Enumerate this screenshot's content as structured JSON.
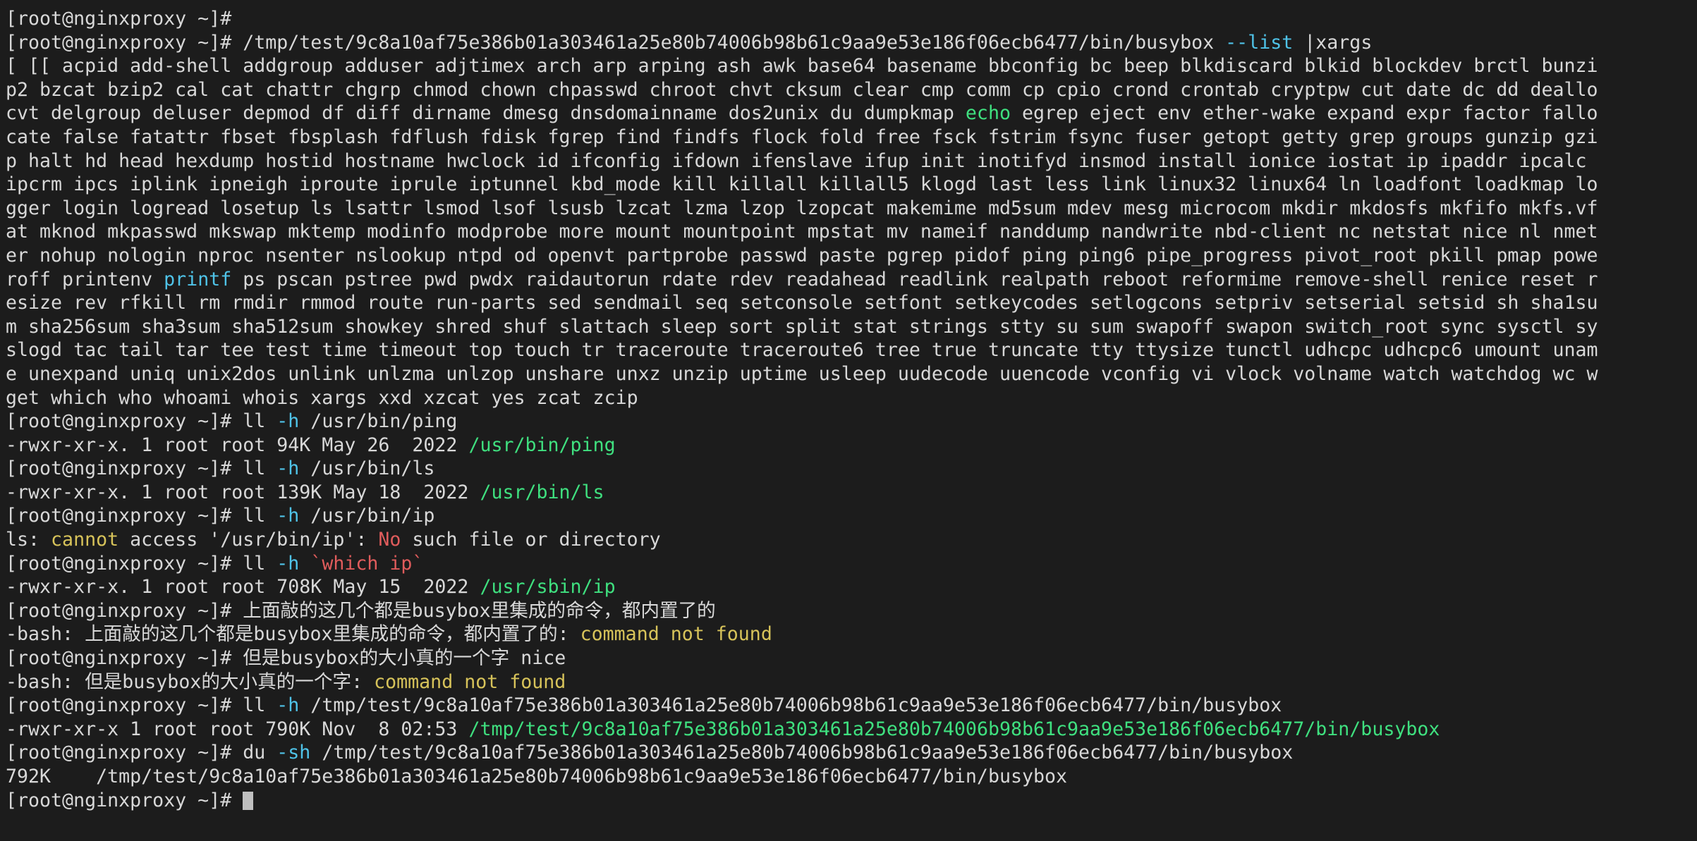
{
  "terminal": {
    "background_color": "#1c1c1c",
    "foreground_color": "#d8d8d8",
    "accent_cyan": "#4fc3e8",
    "accent_green": "#3fe07f",
    "accent_red": "#e05c5c",
    "accent_yellow": "#d7c35a",
    "prompt": "[root@nginxproxy ~]#",
    "busybox_path": "/tmp/test/9c8a10af75e386b01a303461a25e80b74006b98b61c9aa9e53e186f06ecb6477/bin/busybox",
    "lines": [
      {
        "id": "line-01-prompt-empty",
        "segments": [
          {
            "t": "[root@nginxproxy ~]# ",
            "c": "w"
          }
        ]
      },
      {
        "id": "line-02-busybox-list-cmd",
        "segments": [
          {
            "t": "[root@nginxproxy ~]# /tmp/test/9c8a10af75e386b01a303461a25e80b74006b98b61c9aa9e53e186f06ecb6477/bin/busybox ",
            "c": "w"
          },
          {
            "t": "--list",
            "c": "cy"
          },
          {
            "t": " |xargs",
            "c": "w"
          }
        ]
      },
      {
        "id": "line-03-applets-a",
        "segments": [
          {
            "t": "[ [[ acpid add-shell addgroup adduser adjtimex arch arp arping ash awk base64 basename bbconfig bc beep blkdiscard blkid blockdev brctl bunzi",
            "c": "w"
          }
        ]
      },
      {
        "id": "line-04-applets-b",
        "segments": [
          {
            "t": "p2 bzcat bzip2 cal cat chattr chgrp chmod chown chpasswd chroot chvt cksum clear cmp comm cp cpio crond crontab cryptpw cut date dc dd deallo",
            "c": "w"
          }
        ]
      },
      {
        "id": "line-05-applets-c",
        "segments": [
          {
            "t": "cvt delgroup deluser depmod df diff dirname dmesg dnsdomainname dos2unix du dumpkmap ",
            "c": "w"
          },
          {
            "t": "echo",
            "c": "gr"
          },
          {
            "t": " egrep eject env ether-wake expand expr factor fallo",
            "c": "w"
          }
        ]
      },
      {
        "id": "line-06-applets-d",
        "segments": [
          {
            "t": "cate false fatattr fbset fbsplash fdflush fdisk fgrep find findfs flock fold free fsck fstrim fsync fuser getopt getty grep groups gunzip gzi",
            "c": "w"
          }
        ]
      },
      {
        "id": "line-07-applets-e",
        "segments": [
          {
            "t": "p halt hd head hexdump hostid hostname hwclock id ifconfig ifdown ifenslave ifup init inotifyd insmod install ionice iostat ip ipaddr ipcalc",
            "c": "w"
          }
        ]
      },
      {
        "id": "line-08-applets-f",
        "segments": [
          {
            "t": "ipcrm ipcs iplink ipneigh iproute iprule iptunnel kbd_mode kill killall killall5 klogd last less link linux32 linux64 ln loadfont loadkmap lo",
            "c": "w"
          }
        ]
      },
      {
        "id": "line-09-applets-g",
        "segments": [
          {
            "t": "gger login logread losetup ls lsattr lsmod lsof lsusb lzcat lzma lzop lzopcat makemime md5sum mdev mesg microcom mkdir mkdosfs mkfifo mkfs.vf",
            "c": "w"
          }
        ]
      },
      {
        "id": "line-10-applets-h",
        "segments": [
          {
            "t": "at mknod mkpasswd mkswap mktemp modinfo modprobe more mount mountpoint mpstat mv nameif nanddump nandwrite nbd-client nc netstat nice nl nmet",
            "c": "w"
          }
        ]
      },
      {
        "id": "line-11-applets-i",
        "segments": [
          {
            "t": "er nohup nologin nproc nsenter nslookup ntpd od openvt partprobe passwd paste pgrep pidof ping ping6 pipe_progress pivot_root pkill pmap powe",
            "c": "w"
          }
        ]
      },
      {
        "id": "line-12-applets-j",
        "segments": [
          {
            "t": "roff printenv ",
            "c": "w"
          },
          {
            "t": "printf",
            "c": "cy"
          },
          {
            "t": " ps pscan pstree pwd pwdx raidautorun rdate rdev readahead readlink realpath reboot reformime remove-shell renice reset r",
            "c": "w"
          }
        ]
      },
      {
        "id": "line-13-applets-k",
        "segments": [
          {
            "t": "esize rev rfkill rm rmdir rmmod route run-parts sed sendmail seq setconsole setfont setkeycodes setlogcons setpriv setserial setsid sh sha1su",
            "c": "w"
          }
        ]
      },
      {
        "id": "line-14-applets-l",
        "segments": [
          {
            "t": "m sha256sum sha3sum sha512sum showkey shred shuf slattach sleep sort split stat strings stty su sum swapoff swapon switch_root sync sysctl sy",
            "c": "w"
          }
        ]
      },
      {
        "id": "line-15-applets-m",
        "segments": [
          {
            "t": "slogd tac tail tar tee test time timeout top touch tr traceroute traceroute6 tree true truncate tty ttysize tunctl udhcpc udhcpc6 umount unam",
            "c": "w"
          }
        ]
      },
      {
        "id": "line-16-applets-n",
        "segments": [
          {
            "t": "e unexpand uniq unix2dos unlink unlzma unlzop unshare unxz unzip uptime usleep uudecode uuencode vconfig vi vlock volname watch watchdog wc w",
            "c": "w"
          }
        ]
      },
      {
        "id": "line-17-applets-o",
        "segments": [
          {
            "t": "get which who whoami whois xargs xxd xzcat yes zcat zcip",
            "c": "w"
          }
        ]
      },
      {
        "id": "line-18-ll-ping-cmd",
        "segments": [
          {
            "t": "[root@nginxproxy ~]# ll ",
            "c": "w"
          },
          {
            "t": "-h",
            "c": "cy"
          },
          {
            "t": " /usr/bin/ping",
            "c": "w"
          }
        ]
      },
      {
        "id": "line-19-ll-ping-out",
        "segments": [
          {
            "t": "-rwxr-xr-x. 1 root root 94K May 26  2022 ",
            "c": "w"
          },
          {
            "t": "/usr/bin/ping",
            "c": "gr"
          }
        ]
      },
      {
        "id": "line-20-ll-ls-cmd",
        "segments": [
          {
            "t": "[root@nginxproxy ~]# ll ",
            "c": "w"
          },
          {
            "t": "-h",
            "c": "cy"
          },
          {
            "t": " /usr/bin/ls",
            "c": "w"
          }
        ]
      },
      {
        "id": "line-21-ll-ls-out",
        "segments": [
          {
            "t": "-rwxr-xr-x. 1 root root 139K May 18  2022 ",
            "c": "w"
          },
          {
            "t": "/usr/bin/ls",
            "c": "gr"
          }
        ]
      },
      {
        "id": "line-22-ll-ip-cmd",
        "segments": [
          {
            "t": "[root@nginxproxy ~]# ll ",
            "c": "w"
          },
          {
            "t": "-h",
            "c": "cy"
          },
          {
            "t": " /usr/bin/ip",
            "c": "w"
          }
        ]
      },
      {
        "id": "line-23-ll-ip-error",
        "segments": [
          {
            "t": "ls: ",
            "c": "w"
          },
          {
            "t": "cannot",
            "c": "ye"
          },
          {
            "t": " access '/usr/bin/ip': ",
            "c": "w"
          },
          {
            "t": "No",
            "c": "rd"
          },
          {
            "t": " such file or directory",
            "c": "w"
          }
        ]
      },
      {
        "id": "line-24-ll-which-ip-cmd",
        "segments": [
          {
            "t": "[root@nginxproxy ~]# ll ",
            "c": "w"
          },
          {
            "t": "-h",
            "c": "cy"
          },
          {
            "t": " ",
            "c": "w"
          },
          {
            "t": "`which ip`",
            "c": "rd"
          }
        ]
      },
      {
        "id": "line-25-which-ip-out",
        "segments": [
          {
            "t": "-rwxr-xr-x. 1 root root 708K May 15  2022 ",
            "c": "w"
          },
          {
            "t": "/usr/sbin/ip",
            "c": "gr"
          }
        ]
      },
      {
        "id": "line-26-cn-note-1-cmd",
        "segments": [
          {
            "t": "[root@nginxproxy ~]# 上面敲的这几个都是busybox里集成的命令，都内置了的",
            "c": "w"
          }
        ]
      },
      {
        "id": "line-27-cn-note-1-err",
        "segments": [
          {
            "t": "-bash: 上面敲的这几个都是busybox里集成的命令，都内置了的: ",
            "c": "w"
          },
          {
            "t": "command not found",
            "c": "ye"
          }
        ]
      },
      {
        "id": "line-28-cn-note-2-cmd",
        "segments": [
          {
            "t": "[root@nginxproxy ~]# 但是busybox的大小真的一个字 nice",
            "c": "w"
          }
        ]
      },
      {
        "id": "line-29-cn-note-2-err",
        "segments": [
          {
            "t": "-bash: 但是busybox的大小真的一个字: ",
            "c": "w"
          },
          {
            "t": "command not found",
            "c": "ye"
          }
        ]
      },
      {
        "id": "line-30-ll-busybox-cmd",
        "segments": [
          {
            "t": "[root@nginxproxy ~]# ll ",
            "c": "w"
          },
          {
            "t": "-h",
            "c": "cy"
          },
          {
            "t": " /tmp/test/9c8a10af75e386b01a303461a25e80b74006b98b61c9aa9e53e186f06ecb6477/bin/busybox",
            "c": "w"
          }
        ]
      },
      {
        "id": "line-31-ll-busybox-out",
        "segments": [
          {
            "t": "-rwxr-xr-x 1 root root 790K Nov  8 02:53 ",
            "c": "w"
          },
          {
            "t": "/tmp/test/9c8a10af75e386b01a303461a25e80b74006b98b61c9aa9e53e186f06ecb6477/bin/busybox",
            "c": "gr"
          }
        ]
      },
      {
        "id": "line-32-du-busybox-cmd",
        "segments": [
          {
            "t": "[root@nginxproxy ~]# du ",
            "c": "w"
          },
          {
            "t": "-sh",
            "c": "cy"
          },
          {
            "t": " /tmp/test/9c8a10af75e386b01a303461a25e80b74006b98b61c9aa9e53e186f06ecb6477/bin/busybox",
            "c": "w"
          }
        ]
      },
      {
        "id": "line-33-du-busybox-out",
        "segments": [
          {
            "t": "792K    /tmp/test/9c8a10af75e386b01a303461a25e80b74006b98b61c9aa9e53e186f06ecb6477/bin/busybox",
            "c": "w"
          }
        ]
      },
      {
        "id": "line-34-final-prompt",
        "segments": [
          {
            "t": "[root@nginxproxy ~]# ",
            "c": "w"
          }
        ],
        "cursor": true
      }
    ]
  }
}
